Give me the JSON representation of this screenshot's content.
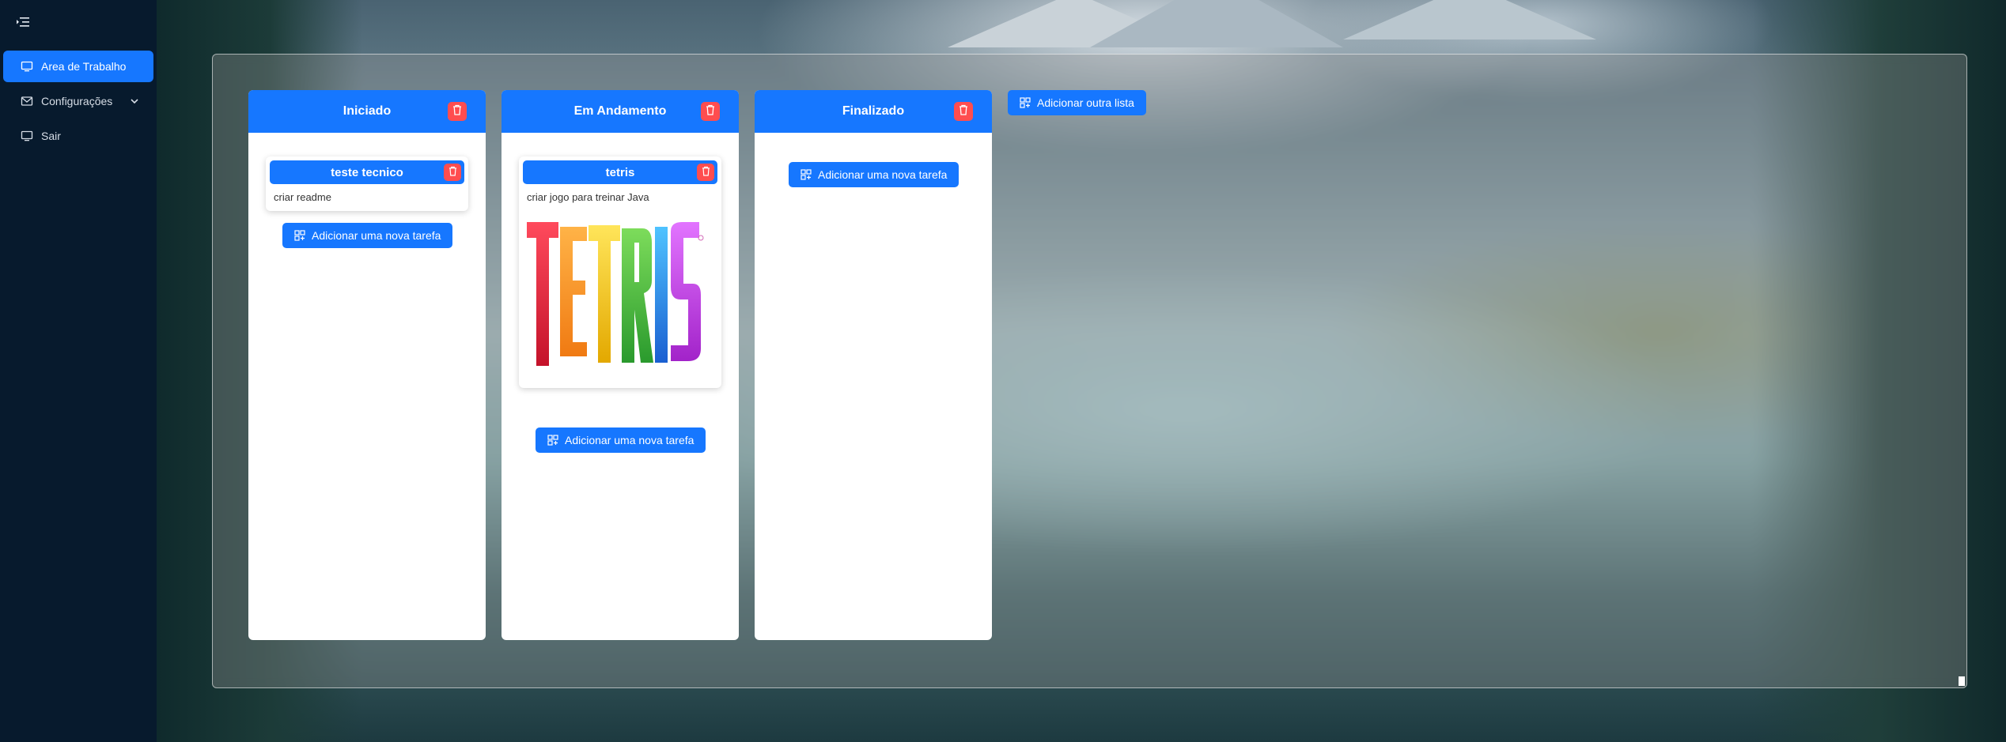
{
  "sidebar": {
    "items": [
      {
        "label": "Area de Trabalho",
        "icon": "desktop-icon",
        "active": true
      },
      {
        "label": "Configurações",
        "icon": "mail-icon",
        "active": false
      },
      {
        "label": "Sair",
        "icon": "desktop-icon",
        "active": false
      }
    ]
  },
  "board": {
    "add_list_label": "Adicionar outra lista",
    "lists": [
      {
        "title": "Iniciado",
        "cards": [
          {
            "title": "teste tecnico",
            "description": "criar readme"
          }
        ],
        "add_task_label": "Adicionar uma nova tarefa"
      },
      {
        "title": "Em Andamento",
        "cards": [
          {
            "title": "tetris",
            "description": "criar jogo para treinar Java",
            "image_text": "TETRIS"
          }
        ],
        "add_task_label": "Adicionar uma nova tarefa"
      },
      {
        "title": "Finalizado",
        "cards": [],
        "add_task_label": "Adicionar uma nova tarefa"
      }
    ]
  },
  "colors": {
    "primary": "#1677ff",
    "danger": "#ff4d4f",
    "sidebar": "#071a2d"
  }
}
